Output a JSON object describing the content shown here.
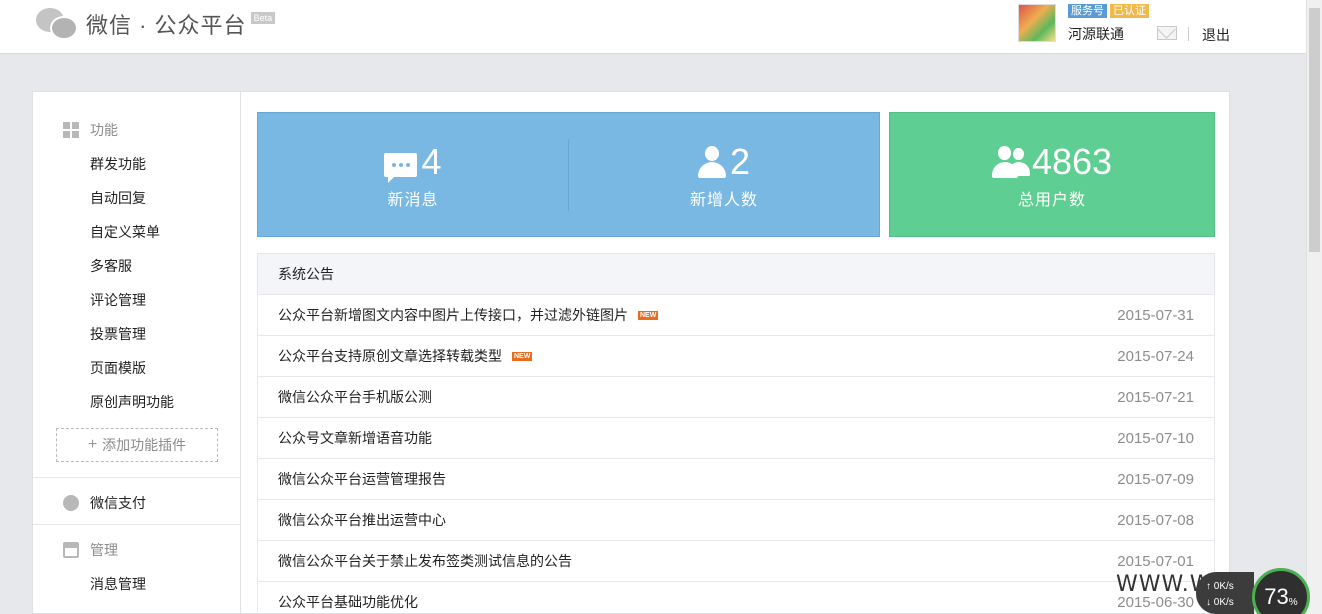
{
  "header": {
    "logo_text": "微信 · 公众平台",
    "beta": "Beta",
    "badge_service": "服务号",
    "badge_verified": "已认证",
    "account_name": "河源联通",
    "logout": "退出"
  },
  "sidebar": {
    "function_head": "功能",
    "function_items": [
      "群发功能",
      "自动回复",
      "自定义菜单",
      "多客服",
      "评论管理",
      "投票管理",
      "页面模版",
      "原创声明功能"
    ],
    "add_plugin": "添加功能插件",
    "pay_head": "微信支付",
    "manage_head": "管理",
    "manage_items": [
      "消息管理"
    ]
  },
  "stats": {
    "new_messages": {
      "value": "4",
      "label": "新消息"
    },
    "new_users": {
      "value": "2",
      "label": "新增人数"
    },
    "total_users": {
      "value": "4863",
      "label": "总用户数"
    }
  },
  "notices": {
    "head": "系统公告",
    "new_label": "NEW",
    "items": [
      {
        "title": "公众平台新增图文内容中图片上传接口，并过滤外链图片",
        "date": "2015-07-31",
        "is_new": true
      },
      {
        "title": "公众平台支持原创文章选择转载类型",
        "date": "2015-07-24",
        "is_new": true
      },
      {
        "title": "微信公众平台手机版公测",
        "date": "2015-07-21",
        "is_new": false
      },
      {
        "title": "公众号文章新增语音功能",
        "date": "2015-07-10",
        "is_new": false
      },
      {
        "title": "微信公众平台运营管理报告",
        "date": "2015-07-09",
        "is_new": false
      },
      {
        "title": "微信公众平台推出运营中心",
        "date": "2015-07-08",
        "is_new": false
      },
      {
        "title": "微信公众平台关于禁止发布签类测试信息的公告",
        "date": "2015-07-01",
        "is_new": false
      },
      {
        "title": "公众平台基础功能优化",
        "date": "2015-06-30",
        "is_new": false
      }
    ]
  },
  "overlay": {
    "watermark": "WWW.W",
    "net_up": "0K/s",
    "net_down": "0K/s",
    "gauge_value": "73",
    "gauge_unit": "%"
  },
  "colors": {
    "stat_blue": "#7ab8e4",
    "stat_green": "#5fce92",
    "new_badge": "#e96d21"
  }
}
